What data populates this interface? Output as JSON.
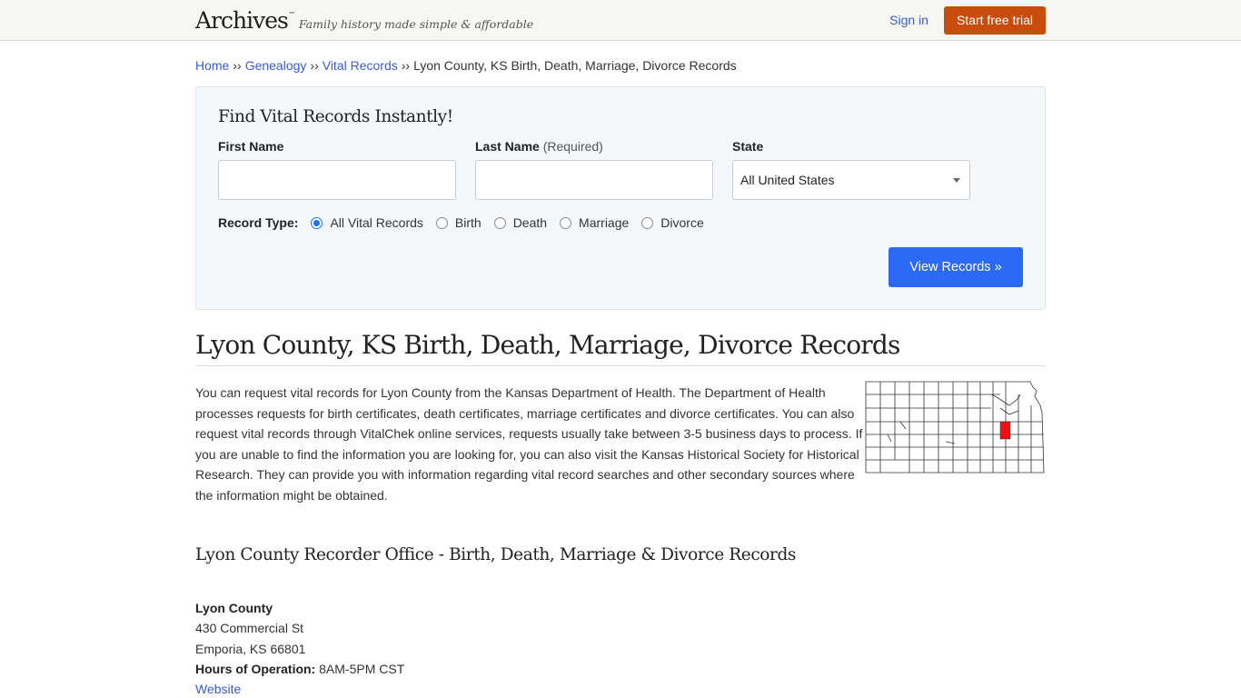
{
  "header": {
    "logo": "Archives",
    "logo_tm": "™",
    "tagline": "Family history made simple & affordable",
    "signin_label": "Sign in",
    "trial_label": "Start free trial"
  },
  "breadcrumb": {
    "items": [
      "Home",
      "Genealogy",
      "Vital Records"
    ],
    "separator": "››",
    "current": "Lyon County, KS Birth, Death, Marriage, Divorce Records"
  },
  "search": {
    "title": "Find Vital Records Instantly!",
    "first_name_label": "First Name",
    "first_name_value": "",
    "last_name_label": "Last Name",
    "last_name_required": "(Required)",
    "last_name_value": "",
    "state_label": "State",
    "state_selected": "All United States",
    "record_type_label": "Record Type:",
    "record_types": [
      "All Vital Records",
      "Birth",
      "Death",
      "Marriage",
      "Divorce"
    ],
    "record_type_selected": "All Vital Records",
    "submit_label": "View Records »"
  },
  "main": {
    "title": "Lyon County, KS Birth, Death, Marriage, Divorce Records",
    "intro": "You can request vital records for Lyon County from the Kansas Department of Health. The Department of Health processes requests for birth certificates, death certificates, marriage certificates and divorce certificates. You can also request vital records through VitalChek online services, requests usually take between 3-5 business days to process. If you are unable to find the information you are looking for, you can also visit the Kansas Historical Society for Historical Research. They can provide you with information regarding vital record searches and other secondary sources where the information might be obtained.",
    "map": {
      "state": "Kansas",
      "highlighted_county": "Lyon County",
      "highlight_color": "#ee1111"
    },
    "section_title": "Lyon County Recorder Office - Birth, Death, Marriage & Divorce Records",
    "office": {
      "name": "Lyon County",
      "address1": "430 Commercial St",
      "address2": "Emporia, KS 66801",
      "hours_label": "Hours of Operation:",
      "hours_value": "8AM-5PM CST",
      "website_label": "Website"
    }
  },
  "colors": {
    "link": "#3a5bd0",
    "trial_button": "#c84c0e",
    "primary_button": "#2b6af5"
  }
}
